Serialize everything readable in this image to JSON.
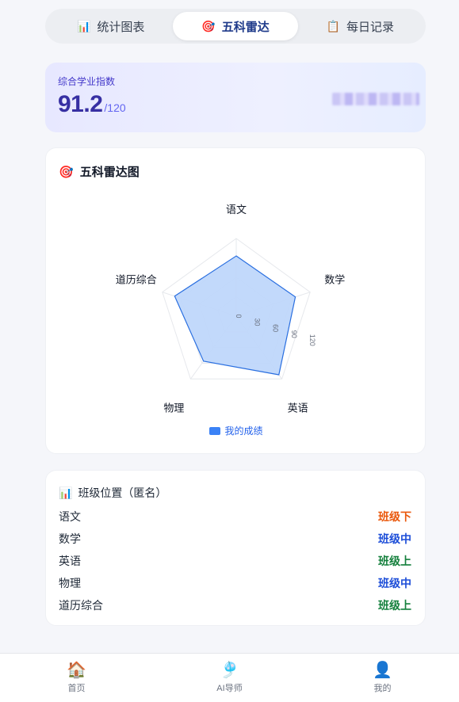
{
  "tabs": [
    {
      "label": "统计图表",
      "icon": "bar-chart-icon",
      "glyph": "📊",
      "active": false
    },
    {
      "label": "五科雷达",
      "icon": "target-icon",
      "glyph": "🎯",
      "active": true
    },
    {
      "label": "每日记录",
      "icon": "clipboard-icon",
      "glyph": "📋",
      "active": false
    }
  ],
  "score": {
    "label": "综合学业指数",
    "value": "91.2",
    "max": "/120"
  },
  "radar": {
    "title": "五科雷达图",
    "title_icon": "🎯",
    "legend": "我的成绩"
  },
  "chart_data": {
    "type": "radar",
    "title": "五科雷达图",
    "axes": [
      "语文",
      "数学",
      "英语",
      "物理",
      "道历综合"
    ],
    "ticks": [
      "0",
      "30",
      "60",
      "90",
      "120"
    ],
    "range": [
      0,
      120
    ],
    "series": [
      {
        "name": "我的成绩",
        "values": [
          93,
          96,
          112,
          86,
          100
        ]
      }
    ],
    "colors": {
      "fill": "#bfd7fb",
      "stroke": "#2a6fe0",
      "grid": "#e6e8ec"
    }
  },
  "rank": {
    "title": "班级位置（匿名）",
    "icon": "📊",
    "rows": [
      {
        "subject": "语文",
        "level": "班级下",
        "color": "#ea580c"
      },
      {
        "subject": "数学",
        "level": "班级中",
        "color": "#1d4ed8"
      },
      {
        "subject": "英语",
        "level": "班级上",
        "color": "#15803d"
      },
      {
        "subject": "物理",
        "level": "班级中",
        "color": "#1d4ed8"
      },
      {
        "subject": "道历综合",
        "level": "班级上",
        "color": "#15803d"
      }
    ]
  },
  "nav": [
    {
      "label": "首页",
      "glyph": "🏠",
      "icon": "home-icon"
    },
    {
      "label": "AI导师",
      "glyph": "🎐",
      "icon": "ai-mentor-icon"
    },
    {
      "label": "我的",
      "glyph": "👤",
      "icon": "profile-icon"
    }
  ]
}
